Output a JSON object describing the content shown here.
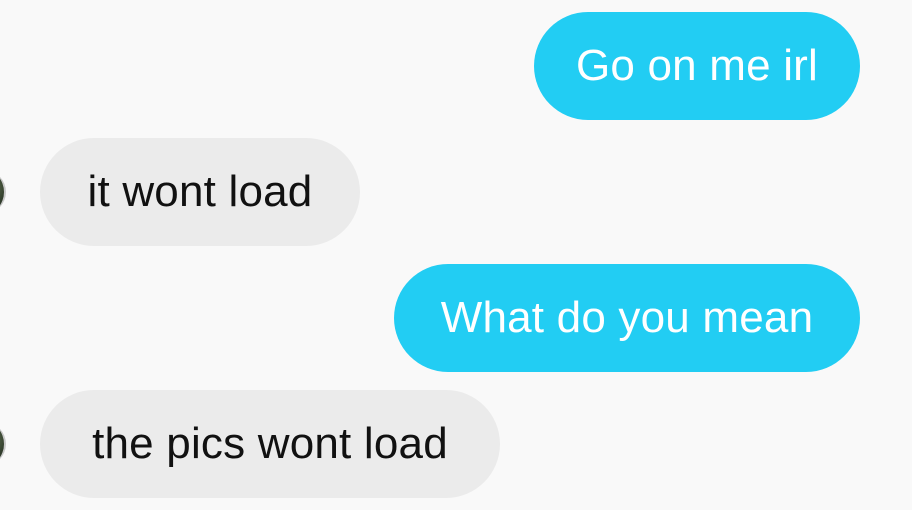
{
  "messages": [
    {
      "direction": "outgoing",
      "text": "Go on me irl"
    },
    {
      "direction": "incoming",
      "text": "it wont load"
    },
    {
      "direction": "outgoing",
      "text": "What do you mean"
    },
    {
      "direction": "incoming",
      "text": "the pics wont load"
    }
  ],
  "colors": {
    "background": "#f9f9f9",
    "outgoing_bubble": "#22cdf3",
    "outgoing_text": "#ffffff",
    "incoming_bubble": "#ebebeb",
    "incoming_text": "#111111"
  }
}
